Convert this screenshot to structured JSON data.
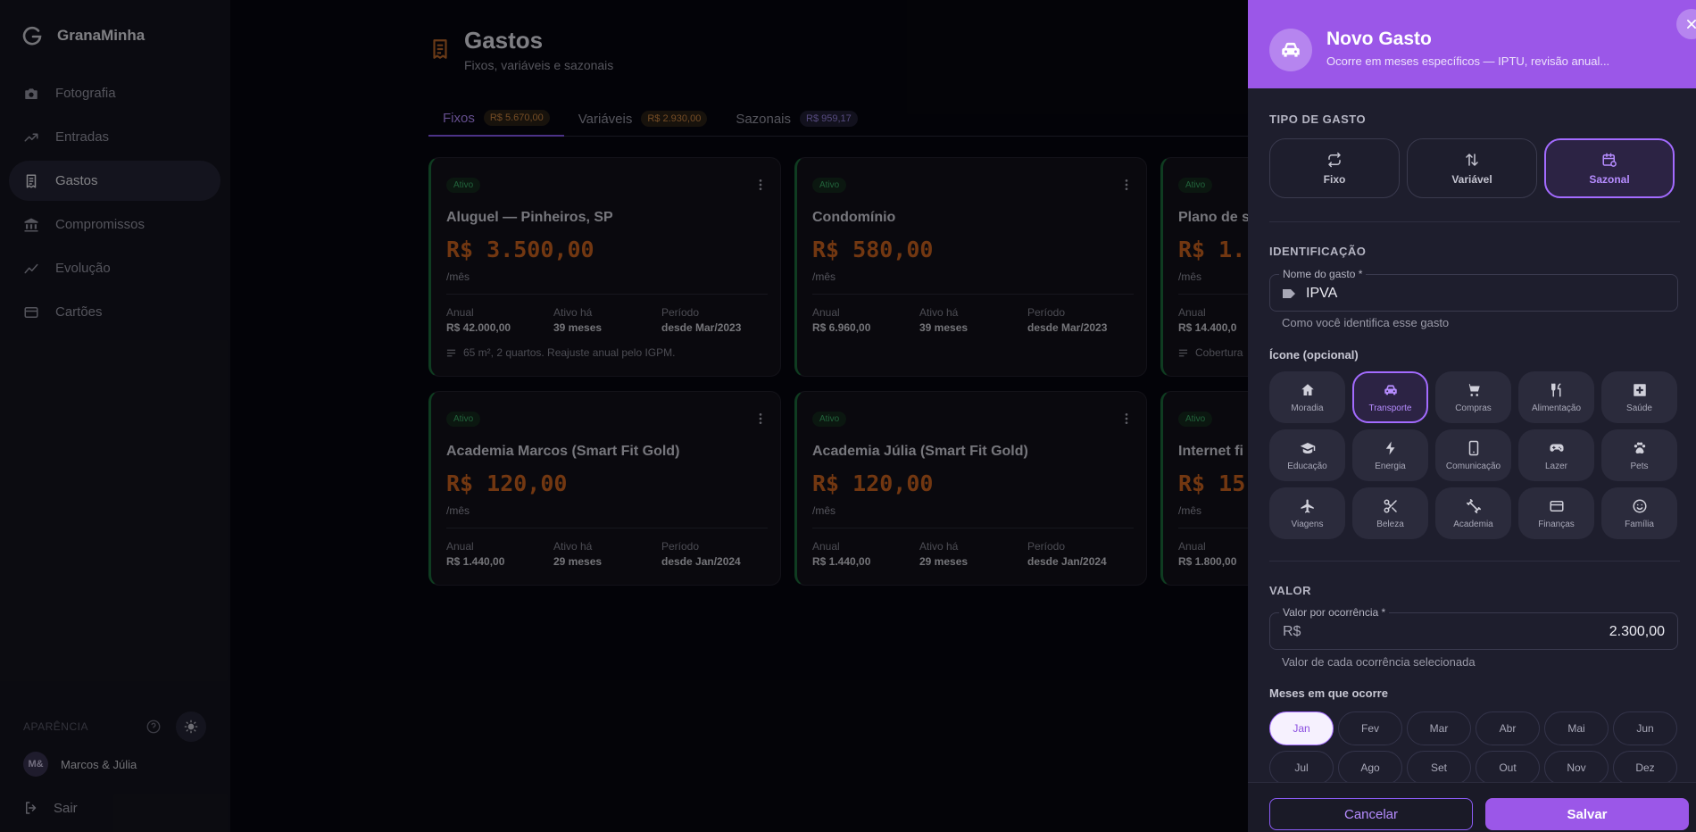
{
  "brand": {
    "name": "GranaMinha"
  },
  "sidebar": {
    "items": [
      {
        "label": "Fotografia",
        "icon": "camera-icon"
      },
      {
        "label": "Entradas",
        "icon": "trending-up-icon"
      },
      {
        "label": "Gastos",
        "icon": "receipt-icon",
        "active": true
      },
      {
        "label": "Compromissos",
        "icon": "bank-icon"
      },
      {
        "label": "Evolução",
        "icon": "line-chart-icon"
      },
      {
        "label": "Cartões",
        "icon": "credit-card-icon"
      }
    ],
    "appearance_label": "APARÊNCIA",
    "user": {
      "initials": "M&",
      "name": "Marcos & Júlia"
    },
    "logout_label": "Sair"
  },
  "header": {
    "title": "Gastos",
    "subtitle": "Fixos, variáveis e sazonais"
  },
  "tabs": [
    {
      "label": "Fixos",
      "badge": "R$ 5.670,00",
      "active": true
    },
    {
      "label": "Variáveis",
      "badge": "R$ 2.930,00"
    },
    {
      "label": "Sazonais",
      "badge": "R$ 959,17"
    }
  ],
  "cards": [
    {
      "status": "Ativo",
      "name": "Aluguel — Pinheiros, SP",
      "value": "R$ 3.500,00",
      "freq": "/mês",
      "annual_label": "Anual",
      "annual": "R$ 42.000,00",
      "since_label": "Ativo há",
      "since": "39 meses",
      "period_label": "Período",
      "period": "desde Mar/2023",
      "note": "65 m², 2 quartos. Reajuste anual pelo IGPM."
    },
    {
      "status": "Ativo",
      "name": "Condomínio",
      "value": "R$ 580,00",
      "freq": "/mês",
      "annual_label": "Anual",
      "annual": "R$ 6.960,00",
      "since_label": "Ativo há",
      "since": "39 meses",
      "period_label": "Período",
      "period": "desde Mar/2023"
    },
    {
      "status": "Ativo",
      "name": "Plano de s",
      "value": "R$ 1.",
      "freq": "/mês",
      "annual_label": "Anual",
      "annual": "R$ 14.400,0",
      "note": "Cobertura"
    },
    {
      "status": "Ativo",
      "name": "Academia Marcos (Smart Fit Gold)",
      "value": "R$ 120,00",
      "freq": "/mês",
      "annual_label": "Anual",
      "annual": "R$ 1.440,00",
      "since_label": "Ativo há",
      "since": "29 meses",
      "period_label": "Período",
      "period": "desde Jan/2024"
    },
    {
      "status": "Ativo",
      "name": "Academia Júlia (Smart Fit Gold)",
      "value": "R$ 120,00",
      "freq": "/mês",
      "annual_label": "Anual",
      "annual": "R$ 1.440,00",
      "since_label": "Ativo há",
      "since": "29 meses",
      "period_label": "Período",
      "period": "desde Jan/2024"
    },
    {
      "status": "Ativo",
      "name": "Internet fi",
      "value": "R$ 15",
      "freq": "/mês",
      "annual_label": "Anual",
      "annual": "R$ 1.800,00"
    }
  ],
  "drawer": {
    "title": "Novo Gasto",
    "subtitle": "Ocorre em meses específicos — IPTU, revisão anual...",
    "type_section": "TIPO DE GASTO",
    "types": [
      {
        "label": "Fixo",
        "icon": "repeat-icon"
      },
      {
        "label": "Variável",
        "icon": "arrows-up-down-icon"
      },
      {
        "label": "Sazonal",
        "icon": "calendar-repeat-icon",
        "active": true
      }
    ],
    "id_section": "IDENTIFICAÇÃO",
    "name_field": {
      "label": "Nome do gasto *",
      "value": "IPVA",
      "helper": "Como você identifica esse gasto"
    },
    "icon_section": "Ícone (opcional)",
    "icons": [
      {
        "label": "Moradia",
        "icon": "home-icon"
      },
      {
        "label": "Transporte",
        "icon": "car-icon",
        "active": true
      },
      {
        "label": "Compras",
        "icon": "cart-icon"
      },
      {
        "label": "Alimentação",
        "icon": "utensils-icon"
      },
      {
        "label": "Saúde",
        "icon": "medical-icon"
      },
      {
        "label": "Educação",
        "icon": "graduation-cap-icon"
      },
      {
        "label": "Energia",
        "icon": "bolt-icon"
      },
      {
        "label": "Comunicação",
        "icon": "phone-icon"
      },
      {
        "label": "Lazer",
        "icon": "gamepad-icon"
      },
      {
        "label": "Pets",
        "icon": "paw-icon"
      },
      {
        "label": "Viagens",
        "icon": "plane-icon"
      },
      {
        "label": "Beleza",
        "icon": "scissors-icon"
      },
      {
        "label": "Academia",
        "icon": "dumbbell-icon"
      },
      {
        "label": "Finanças",
        "icon": "card-icon"
      },
      {
        "label": "Família",
        "icon": "face-icon"
      }
    ],
    "value_section": "VALOR",
    "value_field": {
      "label": "Valor por ocorrência *",
      "currency": "R$",
      "value": "2.300,00",
      "helper": "Valor de cada ocorrência selecionada"
    },
    "months_label": "Meses em que ocorre",
    "months": [
      {
        "label": "Jan",
        "active": true
      },
      {
        "label": "Fev"
      },
      {
        "label": "Mar"
      },
      {
        "label": "Abr"
      },
      {
        "label": "Mai"
      },
      {
        "label": "Jun"
      },
      {
        "label": "Jul"
      },
      {
        "label": "Ago"
      },
      {
        "label": "Set"
      },
      {
        "label": "Out"
      },
      {
        "label": "Nov"
      },
      {
        "label": "Dez"
      }
    ],
    "cancel_label": "Cancelar",
    "save_label": "Salvar"
  },
  "colors": {
    "accent": "#9b57e8",
    "expense": "#d0651f",
    "active_green": "#3cb36a",
    "background": "#07070f"
  }
}
